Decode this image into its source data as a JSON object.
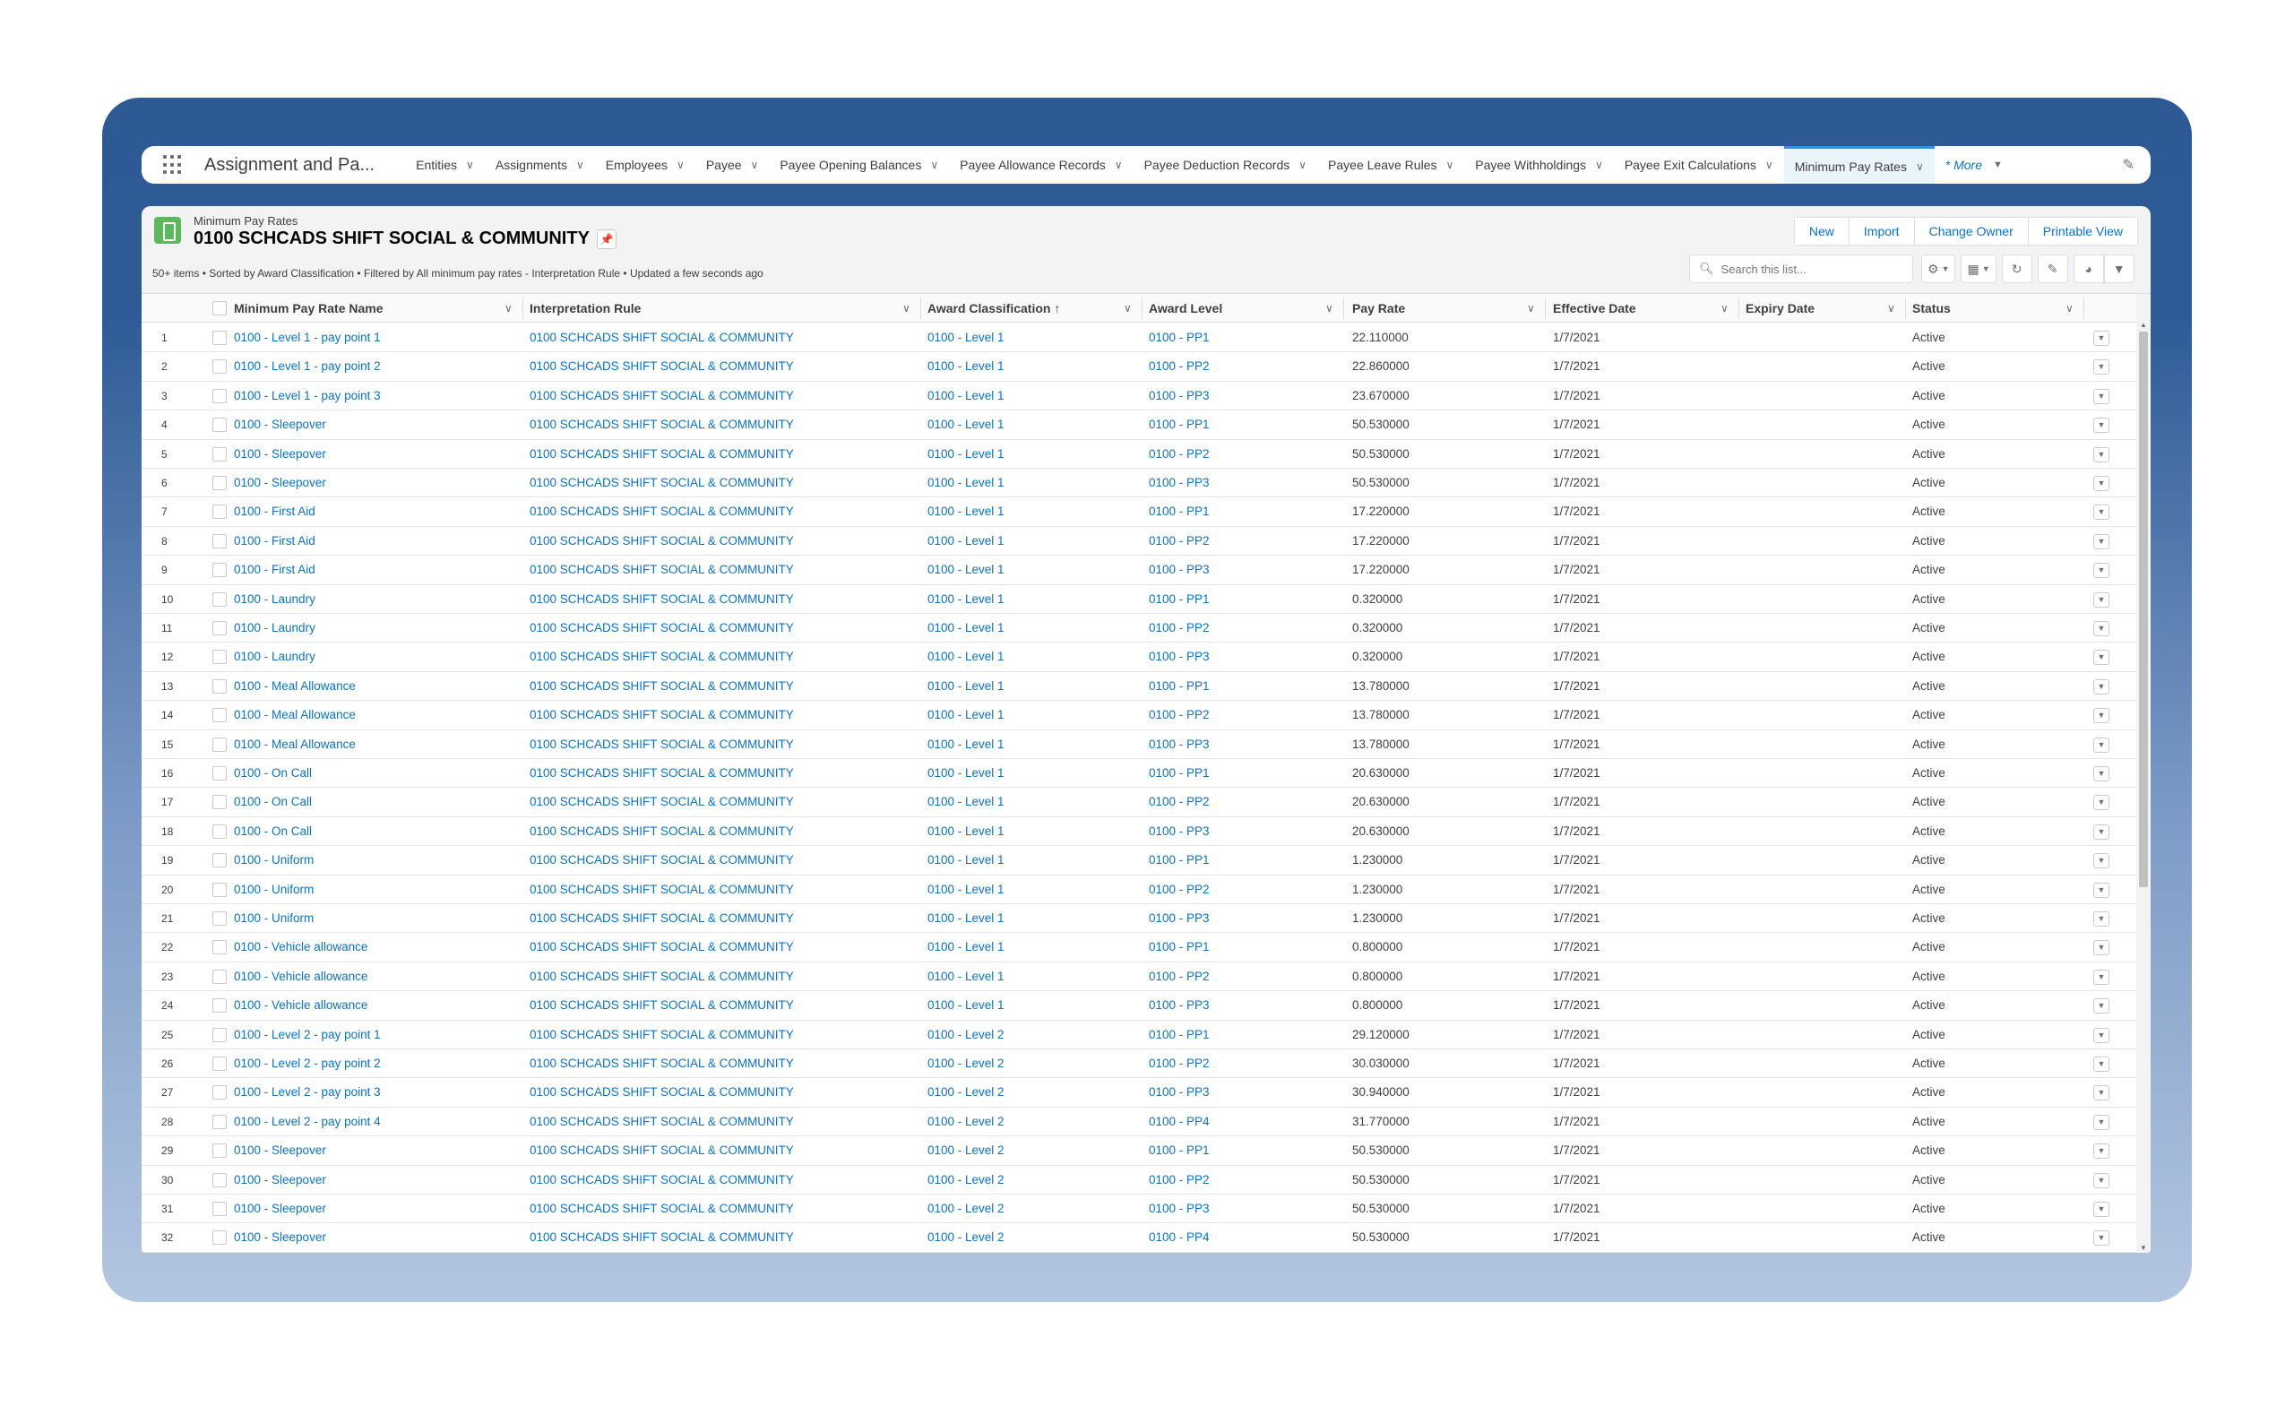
{
  "nav": {
    "app_name": "Assignment and Pa...",
    "tabs": [
      {
        "label": "Entities"
      },
      {
        "label": "Assignments"
      },
      {
        "label": "Employees"
      },
      {
        "label": "Payee"
      },
      {
        "label": "Payee Opening Balances"
      },
      {
        "label": "Payee Allowance Records"
      },
      {
        "label": "Payee Deduction Records"
      },
      {
        "label": "Payee Leave Rules"
      },
      {
        "label": "Payee Withholdings"
      },
      {
        "label": "Payee Exit Calculations"
      },
      {
        "label": "Minimum Pay Rates",
        "active": true
      }
    ],
    "more_label": "* More"
  },
  "list": {
    "object_label": "Minimum Pay Rates",
    "title": "0100 SCHCADS SHIFT SOCIAL & COMMUNITY",
    "meta": "50+ items • Sorted by Award Classification • Filtered by All minimum pay rates - Interpretation Rule • Updated a few seconds ago",
    "buttons": {
      "new": "New",
      "import": "Import",
      "change_owner": "Change Owner",
      "printable_view": "Printable View"
    },
    "search_placeholder": "Search this list..."
  },
  "columns": [
    "Minimum Pay Rate Name",
    "Interpretation Rule",
    "Award Classification ↑",
    "Award Level",
    "Pay Rate",
    "Effective Date",
    "Expiry Date",
    "Status"
  ],
  "rows": [
    [
      "1",
      "0100 - Level 1 - pay point 1",
      "0100 SCHCADS SHIFT SOCIAL & COMMUNITY",
      "0100 - Level 1",
      "0100 - PP1",
      "22.110000",
      "1/7/2021",
      "",
      "Active"
    ],
    [
      "2",
      "0100 - Level 1 - pay point 2",
      "0100 SCHCADS SHIFT SOCIAL & COMMUNITY",
      "0100 - Level 1",
      "0100 - PP2",
      "22.860000",
      "1/7/2021",
      "",
      "Active"
    ],
    [
      "3",
      "0100 - Level 1 - pay point 3",
      "0100 SCHCADS SHIFT SOCIAL & COMMUNITY",
      "0100 - Level 1",
      "0100 - PP3",
      "23.670000",
      "1/7/2021",
      "",
      "Active"
    ],
    [
      "4",
      "0100 - Sleepover",
      "0100 SCHCADS SHIFT SOCIAL & COMMUNITY",
      "0100 - Level 1",
      "0100 - PP1",
      "50.530000",
      "1/7/2021",
      "",
      "Active"
    ],
    [
      "5",
      "0100 - Sleepover",
      "0100 SCHCADS SHIFT SOCIAL & COMMUNITY",
      "0100 - Level 1",
      "0100 - PP2",
      "50.530000",
      "1/7/2021",
      "",
      "Active"
    ],
    [
      "6",
      "0100 - Sleepover",
      "0100 SCHCADS SHIFT SOCIAL & COMMUNITY",
      "0100 - Level 1",
      "0100 - PP3",
      "50.530000",
      "1/7/2021",
      "",
      "Active"
    ],
    [
      "7",
      "0100 - First Aid",
      "0100 SCHCADS SHIFT SOCIAL & COMMUNITY",
      "0100 - Level 1",
      "0100 - PP1",
      "17.220000",
      "1/7/2021",
      "",
      "Active"
    ],
    [
      "8",
      "0100 - First Aid",
      "0100 SCHCADS SHIFT SOCIAL & COMMUNITY",
      "0100 - Level 1",
      "0100 - PP2",
      "17.220000",
      "1/7/2021",
      "",
      "Active"
    ],
    [
      "9",
      "0100 - First Aid",
      "0100 SCHCADS SHIFT SOCIAL & COMMUNITY",
      "0100 - Level 1",
      "0100 - PP3",
      "17.220000",
      "1/7/2021",
      "",
      "Active"
    ],
    [
      "10",
      "0100 - Laundry",
      "0100 SCHCADS SHIFT SOCIAL & COMMUNITY",
      "0100 - Level 1",
      "0100 - PP1",
      "0.320000",
      "1/7/2021",
      "",
      "Active"
    ],
    [
      "11",
      "0100 - Laundry",
      "0100 SCHCADS SHIFT SOCIAL & COMMUNITY",
      "0100 - Level 1",
      "0100 - PP2",
      "0.320000",
      "1/7/2021",
      "",
      "Active"
    ],
    [
      "12",
      "0100 - Laundry",
      "0100 SCHCADS SHIFT SOCIAL & COMMUNITY",
      "0100 - Level 1",
      "0100 - PP3",
      "0.320000",
      "1/7/2021",
      "",
      "Active"
    ],
    [
      "13",
      "0100 - Meal Allowance",
      "0100 SCHCADS SHIFT SOCIAL & COMMUNITY",
      "0100 - Level 1",
      "0100 - PP1",
      "13.780000",
      "1/7/2021",
      "",
      "Active"
    ],
    [
      "14",
      "0100 - Meal Allowance",
      "0100 SCHCADS SHIFT SOCIAL & COMMUNITY",
      "0100 - Level 1",
      "0100 - PP2",
      "13.780000",
      "1/7/2021",
      "",
      "Active"
    ],
    [
      "15",
      "0100 - Meal Allowance",
      "0100 SCHCADS SHIFT SOCIAL & COMMUNITY",
      "0100 - Level 1",
      "0100 - PP3",
      "13.780000",
      "1/7/2021",
      "",
      "Active"
    ],
    [
      "16",
      "0100 - On Call",
      "0100 SCHCADS SHIFT SOCIAL & COMMUNITY",
      "0100 - Level 1",
      "0100 - PP1",
      "20.630000",
      "1/7/2021",
      "",
      "Active"
    ],
    [
      "17",
      "0100 - On Call",
      "0100 SCHCADS SHIFT SOCIAL & COMMUNITY",
      "0100 - Level 1",
      "0100 - PP2",
      "20.630000",
      "1/7/2021",
      "",
      "Active"
    ],
    [
      "18",
      "0100 - On Call",
      "0100 SCHCADS SHIFT SOCIAL & COMMUNITY",
      "0100 - Level 1",
      "0100 - PP3",
      "20.630000",
      "1/7/2021",
      "",
      "Active"
    ],
    [
      "19",
      "0100 - Uniform",
      "0100 SCHCADS SHIFT SOCIAL & COMMUNITY",
      "0100 - Level 1",
      "0100 - PP1",
      "1.230000",
      "1/7/2021",
      "",
      "Active"
    ],
    [
      "20",
      "0100 - Uniform",
      "0100 SCHCADS SHIFT SOCIAL & COMMUNITY",
      "0100 - Level 1",
      "0100 - PP2",
      "1.230000",
      "1/7/2021",
      "",
      "Active"
    ],
    [
      "21",
      "0100 - Uniform",
      "0100 SCHCADS SHIFT SOCIAL & COMMUNITY",
      "0100 - Level 1",
      "0100 - PP3",
      "1.230000",
      "1/7/2021",
      "",
      "Active"
    ],
    [
      "22",
      "0100 - Vehicle allowance",
      "0100 SCHCADS SHIFT SOCIAL & COMMUNITY",
      "0100 - Level 1",
      "0100 - PP1",
      "0.800000",
      "1/7/2021",
      "",
      "Active"
    ],
    [
      "23",
      "0100 - Vehicle allowance",
      "0100 SCHCADS SHIFT SOCIAL & COMMUNITY",
      "0100 - Level 1",
      "0100 - PP2",
      "0.800000",
      "1/7/2021",
      "",
      "Active"
    ],
    [
      "24",
      "0100 - Vehicle allowance",
      "0100 SCHCADS SHIFT SOCIAL & COMMUNITY",
      "0100 - Level 1",
      "0100 - PP3",
      "0.800000",
      "1/7/2021",
      "",
      "Active"
    ],
    [
      "25",
      "0100 - Level 2 - pay point 1",
      "0100 SCHCADS SHIFT SOCIAL & COMMUNITY",
      "0100 - Level 2",
      "0100 - PP1",
      "29.120000",
      "1/7/2021",
      "",
      "Active"
    ],
    [
      "26",
      "0100 - Level 2 - pay point 2",
      "0100 SCHCADS SHIFT SOCIAL & COMMUNITY",
      "0100 - Level 2",
      "0100 - PP2",
      "30.030000",
      "1/7/2021",
      "",
      "Active"
    ],
    [
      "27",
      "0100 - Level 2 - pay point 3",
      "0100 SCHCADS SHIFT SOCIAL & COMMUNITY",
      "0100 - Level 2",
      "0100 - PP3",
      "30.940000",
      "1/7/2021",
      "",
      "Active"
    ],
    [
      "28",
      "0100 - Level 2 - pay point 4",
      "0100 SCHCADS SHIFT SOCIAL & COMMUNITY",
      "0100 - Level 2",
      "0100 - PP4",
      "31.770000",
      "1/7/2021",
      "",
      "Active"
    ],
    [
      "29",
      "0100 - Sleepover",
      "0100 SCHCADS SHIFT SOCIAL & COMMUNITY",
      "0100 - Level 2",
      "0100 - PP1",
      "50.530000",
      "1/7/2021",
      "",
      "Active"
    ],
    [
      "30",
      "0100 - Sleepover",
      "0100 SCHCADS SHIFT SOCIAL & COMMUNITY",
      "0100 - Level 2",
      "0100 - PP2",
      "50.530000",
      "1/7/2021",
      "",
      "Active"
    ],
    [
      "31",
      "0100 - Sleepover",
      "0100 SCHCADS SHIFT SOCIAL & COMMUNITY",
      "0100 - Level 2",
      "0100 - PP3",
      "50.530000",
      "1/7/2021",
      "",
      "Active"
    ],
    [
      "32",
      "0100 - Sleepover",
      "0100 SCHCADS SHIFT SOCIAL & COMMUNITY",
      "0100 - Level 2",
      "0100 - PP4",
      "50.530000",
      "1/7/2021",
      "",
      "Active"
    ]
  ],
  "colors": {
    "link": "#0b72c4",
    "frame_top": "#2e5b96",
    "frame_bottom": "#b3c6e0",
    "object_icon": "#5cb85c",
    "active_tab_bar": "#1b96ff"
  }
}
